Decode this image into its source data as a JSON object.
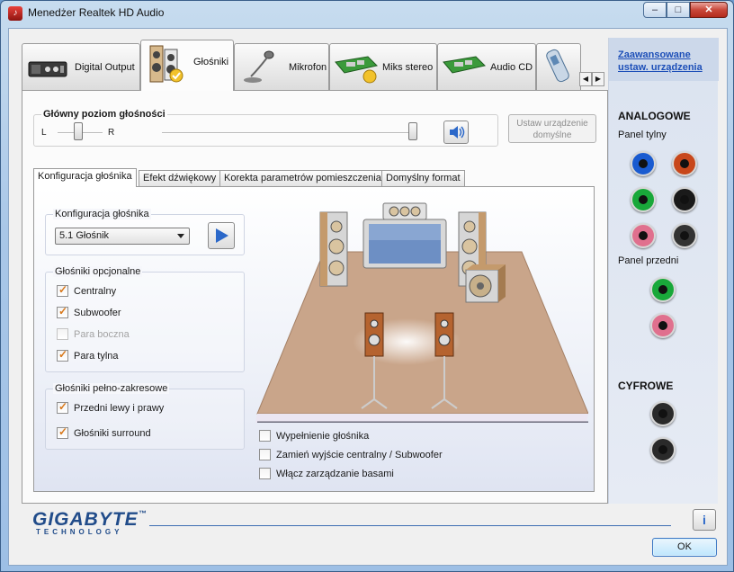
{
  "window": {
    "title": "Menedżer Realtek HD Audio"
  },
  "titlebar_buttons": {
    "minimize": "–",
    "maximize": "□",
    "close": "✕"
  },
  "tabs": [
    {
      "label": "Digital Output",
      "icon": "digital-output-device-icon"
    },
    {
      "label": "Głośniki",
      "icon": "speakers-icon",
      "active": true
    },
    {
      "label": "Mikrofon",
      "icon": "microphone-icon"
    },
    {
      "label": "Miks stereo",
      "icon": "sound-card-icon"
    },
    {
      "label": "Audio CD",
      "icon": "sound-card-icon"
    },
    {
      "label": "",
      "icon": "portable-device-icon"
    }
  ],
  "tab_scroll": {
    "left": "◀",
    "right": "▶"
  },
  "volume": {
    "label": "Główny poziom głośności",
    "left_label": "L",
    "right_label": "R",
    "balance": 0.5,
    "level": 1.0,
    "set_default_button": "Ustaw urządzenie domyślne"
  },
  "subtabs": [
    {
      "label": "Konfiguracja głośnika",
      "active": true
    },
    {
      "label": "Efekt dźwiękowy"
    },
    {
      "label": "Korekta parametrów pomieszczenia"
    },
    {
      "label": "Domyślny format"
    }
  ],
  "speaker_config": {
    "group_label": "Konfiguracja głośnika",
    "selected": "5.1 Głośnik"
  },
  "optional_speakers": {
    "group_label": "Głośniki opcjonalne",
    "items": [
      {
        "label": "Centralny",
        "checked": true,
        "enabled": true
      },
      {
        "label": "Subwoofer",
        "checked": true,
        "enabled": true
      },
      {
        "label": "Para boczna",
        "checked": false,
        "enabled": false
      },
      {
        "label": "Para tylna",
        "checked": true,
        "enabled": true
      }
    ]
  },
  "fullrange": {
    "group_label": "Głośniki pełno-zakresowe",
    "items": [
      {
        "label": "Przedni lewy i prawy",
        "checked": true
      },
      {
        "label": "Głośniki surround",
        "checked": true
      }
    ]
  },
  "options": [
    {
      "label": "Wypełnienie głośnika",
      "checked": false
    },
    {
      "label": "Zamień wyjście centralny / Subwoofer",
      "checked": false
    },
    {
      "label": "Włącz zarządzanie basami",
      "checked": false
    }
  ],
  "sidebar": {
    "advanced_link": "Zaawansowane ustaw. urządzenia",
    "analog_title": "ANALOGOWE",
    "rear_panel": "Panel tylny",
    "front_panel": "Panel przedni",
    "digital_title": "CYFROWE",
    "rear_jacks": [
      "#1a5bd0",
      "#c8471b",
      "#19a83a",
      "#1a1a1a",
      "#e0708e",
      "#333333"
    ],
    "front_jacks": [
      "#19a83a",
      "#e0708e"
    ],
    "digital_jacks": [
      "#2a2a2a",
      "#2a2a2a"
    ]
  },
  "footer": {
    "logo": "GIGABYTE",
    "logo_tm": "™",
    "logo_sub": "TECHNOLOGY",
    "info": "i",
    "ok": "OK"
  },
  "colors": {
    "accent": "#2b68c9",
    "link": "#1d4fb8",
    "floor": "#c9a58a"
  }
}
